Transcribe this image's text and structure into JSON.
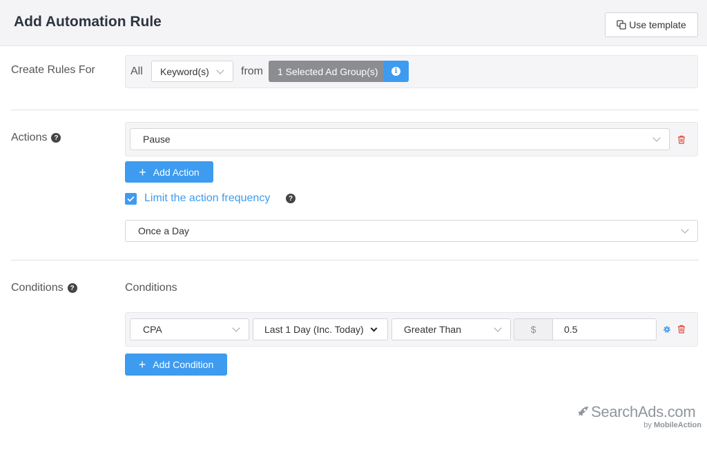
{
  "header": {
    "title": "Add Automation Rule",
    "use_template_label": "Use template"
  },
  "create_rules": {
    "label": "Create Rules For",
    "all_text": "All",
    "entity_select": "Keyword(s)",
    "from_text": "from",
    "ad_group_label": "1 Selected Ad Group(s)"
  },
  "actions": {
    "label": "Actions",
    "action_select": "Pause",
    "add_action_label": "Add Action",
    "limit_checkbox_checked": true,
    "limit_label": "Limit the action frequency",
    "frequency_select": "Once a Day"
  },
  "conditions": {
    "label": "Conditions",
    "section_title": "Conditions",
    "metric_select": "CPA",
    "period_select": "Last 1 Day (Inc. Today)",
    "operator_select": "Greater Than",
    "currency_symbol": "$",
    "value": "0.5",
    "add_condition_label": "Add Condition"
  },
  "branding": {
    "logo_main": "SearchAds.com",
    "logo_sub_prefix": "by ",
    "logo_sub_brand": "MobileAction"
  },
  "colors": {
    "accent": "#3d9bf0",
    "danger": "#e0483b",
    "ad_group_bg": "#8b8d91"
  },
  "icons": {
    "help": "question-circle-icon",
    "info": "info-circle-icon",
    "delete": "trash-icon",
    "settings": "gear-icon",
    "template": "copy-icon",
    "add": "plus-icon",
    "dropdown": "chevron-down-icon",
    "check": "check-icon"
  }
}
